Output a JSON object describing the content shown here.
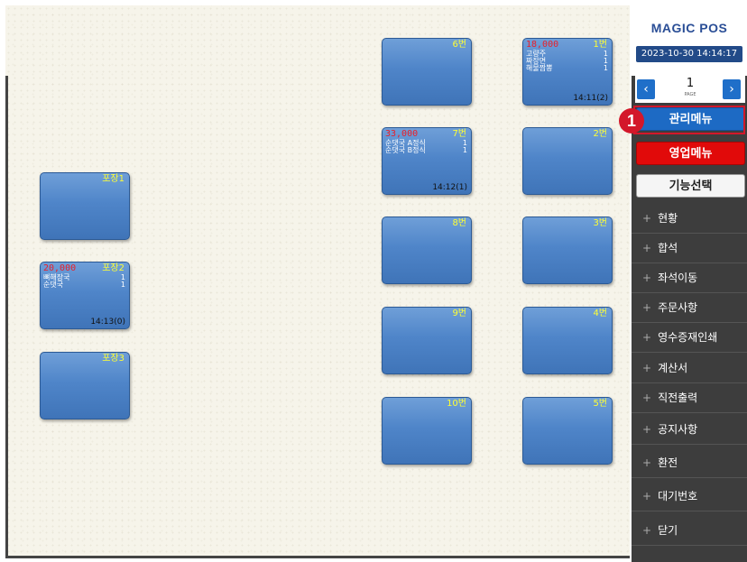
{
  "header": {
    "brand": "MAGIC POS",
    "datetime": "2023-10-30 14:14:17"
  },
  "pager": {
    "page": "1",
    "page_label": "PAGE",
    "prev_icon": "chevron-left-icon",
    "next_icon": "chevron-right-icon"
  },
  "buttons": {
    "manage": "관리메뉴",
    "sales": "영업메뉴",
    "function": "기능선택"
  },
  "menu": [
    "현황",
    "합석",
    "좌석이동",
    "주문사항",
    "영수증재인쇄",
    "계산서",
    "직전출력",
    "공지사항",
    "환전",
    "대기번호",
    "닫기"
  ],
  "annotation": {
    "step": "1"
  },
  "tables": [
    {
      "name": "포장1",
      "amount": "",
      "items": [],
      "time": ""
    },
    {
      "name": "포장2",
      "amount": "20,000",
      "items": [
        {
          "name": "뼈해장국",
          "qty": "1"
        },
        {
          "name": "순댓국",
          "qty": "1"
        }
      ],
      "time": "14:13(0)"
    },
    {
      "name": "포장3",
      "amount": "",
      "items": [],
      "time": ""
    },
    {
      "name": "6번",
      "amount": "",
      "items": [],
      "time": ""
    },
    {
      "name": "7번",
      "amount": "33,000",
      "items": [
        {
          "name": "순댓국 A정식",
          "qty": "1"
        },
        {
          "name": "순댓국 B정식",
          "qty": "1"
        }
      ],
      "time": "14:12(1)"
    },
    {
      "name": "8번",
      "amount": "",
      "items": [],
      "time": ""
    },
    {
      "name": "9번",
      "amount": "",
      "items": [],
      "time": ""
    },
    {
      "name": "10번",
      "amount": "",
      "items": [],
      "time": ""
    },
    {
      "name": "1번",
      "amount": "18,000",
      "items": [
        {
          "name": "고량주",
          "qty": "1"
        },
        {
          "name": "짜장면",
          "qty": "1"
        },
        {
          "name": "해물짬뽕",
          "qty": "1"
        }
      ],
      "time": "14:11(2)"
    },
    {
      "name": "2번",
      "amount": "",
      "items": [],
      "time": ""
    },
    {
      "name": "3번",
      "amount": "",
      "items": [],
      "time": ""
    },
    {
      "name": "4번",
      "amount": "",
      "items": [],
      "time": ""
    },
    {
      "name": "5번",
      "amount": "",
      "items": [],
      "time": ""
    }
  ]
}
